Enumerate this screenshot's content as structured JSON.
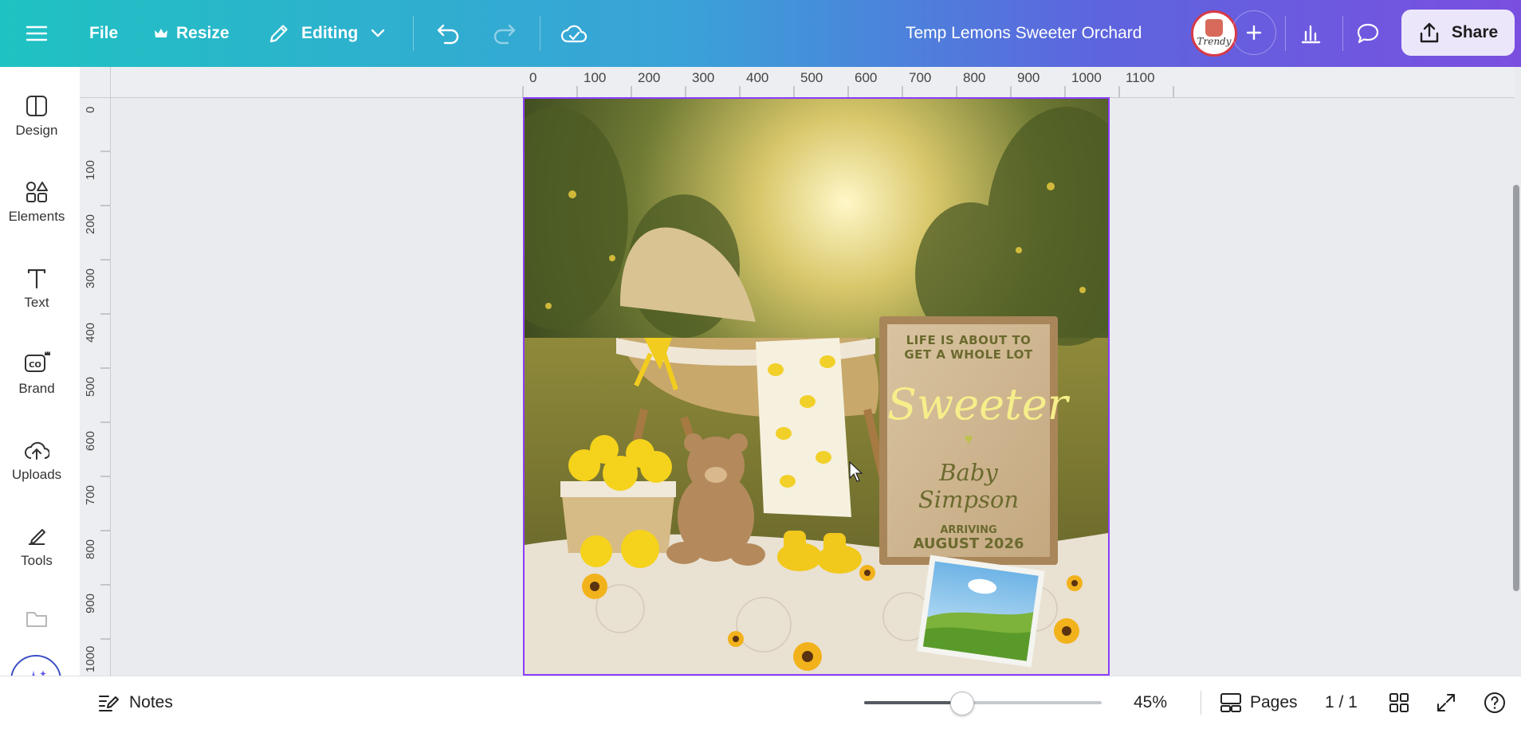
{
  "topbar": {
    "file_label": "File",
    "resize_label": "Resize",
    "editing_label": "Editing",
    "title": "Temp Lemons Sweeter Orchard",
    "avatar_text": "Trendy",
    "share_label": "Share"
  },
  "sidebar": {
    "items": [
      {
        "label": "Design",
        "icon": "design-icon"
      },
      {
        "label": "Elements",
        "icon": "elements-icon"
      },
      {
        "label": "Text",
        "icon": "text-icon"
      },
      {
        "label": "Brand",
        "icon": "brand-icon"
      },
      {
        "label": "Uploads",
        "icon": "uploads-icon"
      },
      {
        "label": "Tools",
        "icon": "tools-icon"
      }
    ]
  },
  "rulers": {
    "top": [
      "0",
      "100",
      "200",
      "300",
      "400",
      "500",
      "600",
      "700",
      "800",
      "900",
      "1000",
      "1100"
    ],
    "left": [
      "0",
      "100",
      "200",
      "300",
      "400",
      "500",
      "600",
      "700",
      "800",
      "900",
      "1000"
    ]
  },
  "sign": {
    "line1": "LIFE IS ABOUT TO",
    "line2": "GET A WHOLE LOT",
    "script": "Sweeter",
    "name": "Baby Simpson",
    "arriving": "ARRIVING",
    "date": "AUGUST 2026"
  },
  "bottombar": {
    "notes_label": "Notes",
    "zoom": "45%",
    "zoom_fraction": 0.41,
    "pages_label": "Pages",
    "page_count": "1 / 1"
  },
  "colors": {
    "accent": "#8b3dff",
    "lemon": "#f5d21b",
    "sign_text": "#6b6a2e"
  }
}
